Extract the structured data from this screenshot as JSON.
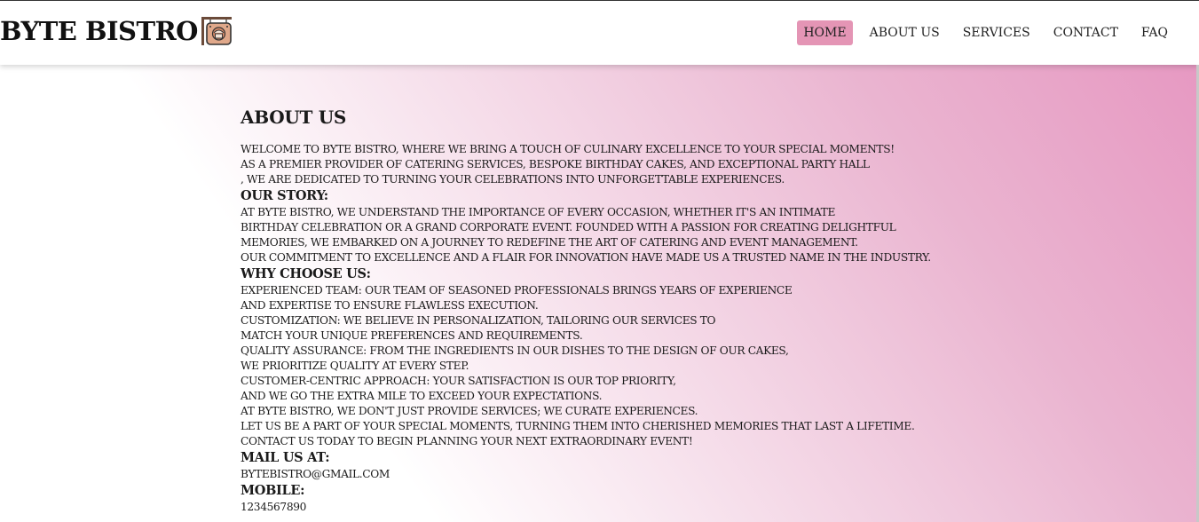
{
  "header": {
    "brand": "BYTE BISTRO",
    "logo_icon": "bistro-sign-icon",
    "nav": [
      {
        "label": "HOME",
        "active": true
      },
      {
        "label": "ABOUT US",
        "active": false
      },
      {
        "label": "SERVICES",
        "active": false
      },
      {
        "label": "CONTACT",
        "active": false
      },
      {
        "label": "FAQ",
        "active": false
      }
    ]
  },
  "about": {
    "title": "ABOUT US",
    "intro": [
      "WELCOME TO BYTE BISTRO, WHERE WE BRING A TOUCH OF CULINARY EXCELLENCE TO YOUR SPECIAL MOMENTS!",
      "AS A PREMIER PROVIDER OF CATERING SERVICES, BESPOKE BIRTHDAY CAKES, AND EXCEPTIONAL PARTY HALL",
      ", WE ARE DEDICATED TO TURNING YOUR CELEBRATIONS INTO UNFORGETTABLE EXPERIENCES."
    ],
    "story_heading": "OUR STORY:",
    "story": [
      "AT BYTE BISTRO, WE UNDERSTAND THE IMPORTANCE OF EVERY OCCASION, WHETHER IT'S AN INTIMATE",
      "BIRTHDAY CELEBRATION OR A GRAND CORPORATE EVENT. FOUNDED WITH A PASSION FOR CREATING DELIGHTFUL",
      "MEMORIES, WE EMBARKED ON A JOURNEY TO REDEFINE THE ART OF CATERING AND EVENT MANAGEMENT.",
      "OUR COMMITMENT TO EXCELLENCE AND A FLAIR FOR INNOVATION HAVE MADE US A TRUSTED NAME IN THE INDUSTRY."
    ],
    "why_heading": "WHY CHOOSE US:",
    "why": [
      "EXPERIENCED TEAM: OUR TEAM OF SEASONED PROFESSIONALS BRINGS YEARS OF EXPERIENCE",
      "AND EXPERTISE TO ENSURE FLAWLESS EXECUTION.",
      "CUSTOMIZATION: WE BELIEVE IN PERSONALIZATION, TAILORING OUR SERVICES TO",
      "MATCH YOUR UNIQUE PREFERENCES AND REQUIREMENTS.",
      "QUALITY ASSURANCE: FROM THE INGREDIENTS IN OUR DISHES TO THE DESIGN OF OUR CAKES,",
      "WE PRIORITIZE QUALITY AT EVERY STEP.",
      "CUSTOMER-CENTRIC APPROACH: YOUR SATISFACTION IS OUR TOP PRIORITY,",
      "AND WE GO THE EXTRA MILE TO EXCEED YOUR EXPECTATIONS.",
      "AT BYTE BISTRO, WE DON'T JUST PROVIDE SERVICES; WE CURATE EXPERIENCES.",
      "LET US BE A PART OF YOUR SPECIAL MOMENTS, TURNING THEM INTO CHERISHED MEMORIES THAT LAST A LIFETIME.",
      "CONTACT US TODAY TO BEGIN PLANNING YOUR NEXT EXTRAORDINARY EVENT!"
    ],
    "mail_heading": "MAIL US AT:",
    "mail": "BYTEBISTRO@GMAIL.COM",
    "mobile_heading": "MOBILE:",
    "mobile": "1234567890"
  },
  "colors": {
    "nav_active_bg": "#e495b5",
    "gradient_pink": "#e695c0"
  }
}
